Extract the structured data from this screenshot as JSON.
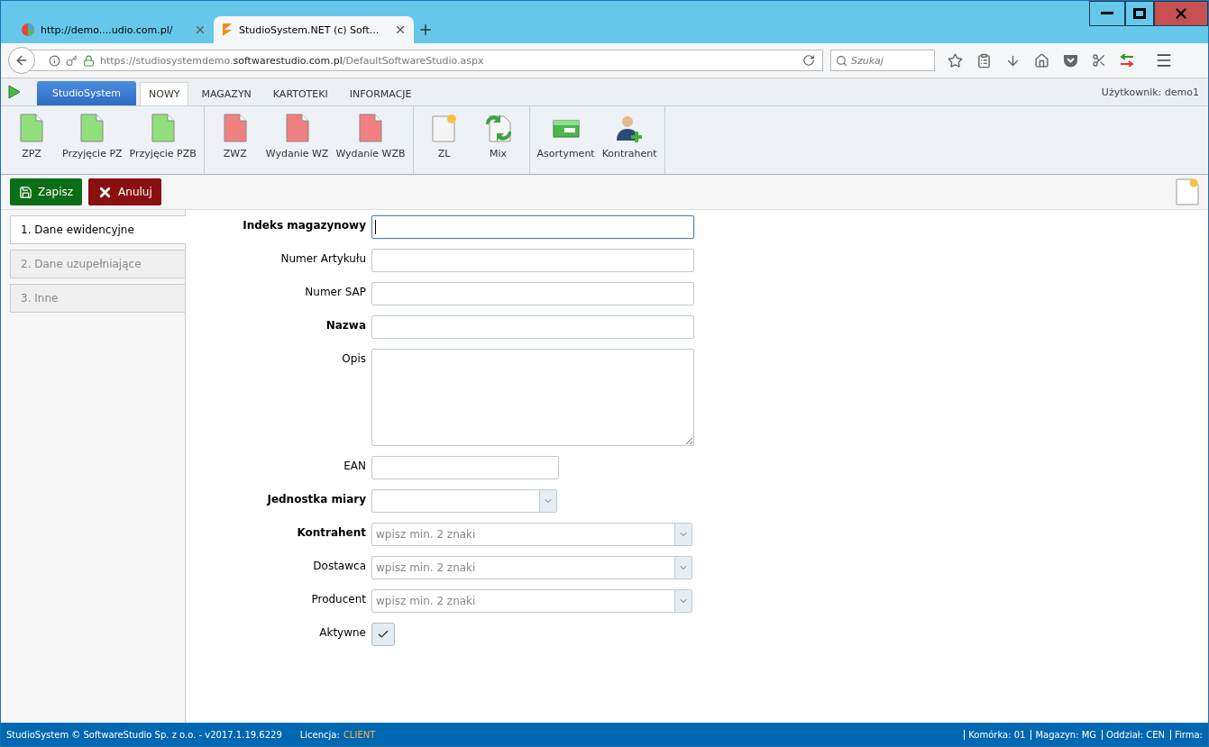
{
  "browser": {
    "tabs": [
      {
        "title": "http://demo....udio.com.pl/",
        "kind": "globe",
        "selected": false
      },
      {
        "title": "StudioSystem.NET (c) Soft...",
        "kind": "studio",
        "selected": true
      }
    ],
    "url": {
      "prefix": "https://studiosystemdemo.",
      "domain": "softwarestudio.com.pl",
      "path": "/DefaultSoftwareStudio.aspx"
    },
    "search": {
      "placeholder": "Szukaj"
    }
  },
  "app": {
    "menu_button": "StudioSystem",
    "tabs": [
      {
        "label": "NOWY",
        "selected": true
      },
      {
        "label": "MAGAZYN",
        "selected": false
      },
      {
        "label": "KARTOTEKI",
        "selected": false
      },
      {
        "label": "INFORMACJE",
        "selected": false
      }
    ],
    "user": "Użytkownik: demo1"
  },
  "ribbon": [
    {
      "items": [
        {
          "label": "ZPZ",
          "kind": "green"
        },
        {
          "label": "Przyjęcie PZ",
          "kind": "green"
        },
        {
          "label": "Przyjęcie PZB",
          "kind": "green"
        }
      ]
    },
    {
      "items": [
        {
          "label": "ZWZ",
          "kind": "red"
        },
        {
          "label": "Wydanie WZ",
          "kind": "red"
        },
        {
          "label": "Wydanie WZB",
          "kind": "red"
        }
      ]
    },
    {
      "items": [
        {
          "label": "ZL",
          "kind": "new"
        },
        {
          "label": "Mix",
          "kind": "mix"
        }
      ]
    },
    {
      "items": [
        {
          "label": "Asortyment",
          "kind": "box"
        },
        {
          "label": "Kontrahent",
          "kind": "person"
        }
      ]
    }
  ],
  "actions": [
    {
      "label": "Zapisz",
      "kind": "save"
    },
    {
      "label": "Anuluj",
      "kind": "cancel"
    }
  ],
  "side_tabs": [
    {
      "label": "1. Dane ewidencyjne",
      "selected": true
    },
    {
      "label": "2. Dane uzupełniające",
      "selected": false
    },
    {
      "label": "3. Inne",
      "selected": false
    }
  ],
  "form": [
    {
      "label": "Indeks magazynowy",
      "kind": "text",
      "required": true,
      "focused": true
    },
    {
      "label": "Numer Artykułu",
      "kind": "text",
      "required": false,
      "focused": false
    },
    {
      "label": "Numer SAP",
      "kind": "text",
      "required": false,
      "focused": false
    },
    {
      "label": "Nazwa",
      "kind": "text",
      "required": true,
      "focused": false
    },
    {
      "label": "Opis",
      "kind": "textarea",
      "required": false
    },
    {
      "label": "EAN",
      "kind": "short",
      "required": false,
      "focused": false
    },
    {
      "label": "Jednostka miary",
      "kind": "select",
      "required": true
    },
    {
      "label": "Kontrahent",
      "kind": "combo",
      "required": true,
      "placeholder": "wpisz min. 2 znaki"
    },
    {
      "label": "Dostawca",
      "kind": "combo",
      "required": false,
      "placeholder": "wpisz min. 2 znaki"
    },
    {
      "label": "Producent",
      "kind": "combo",
      "required": false,
      "placeholder": "wpisz min. 2 znaki"
    },
    {
      "label": "Aktywne",
      "kind": "checkbox",
      "required": false,
      "checked": true
    }
  ],
  "status_bar": {
    "text": "StudioSystem © SoftwareStudio Sp. z o.o. - v2017.1.19.6229",
    "license_label": "Licencja:",
    "license_value": "CLIENT",
    "items": [
      "Komórka: 01",
      "Magazyn: MG",
      "Oddział: CEN",
      "Firma:"
    ]
  }
}
